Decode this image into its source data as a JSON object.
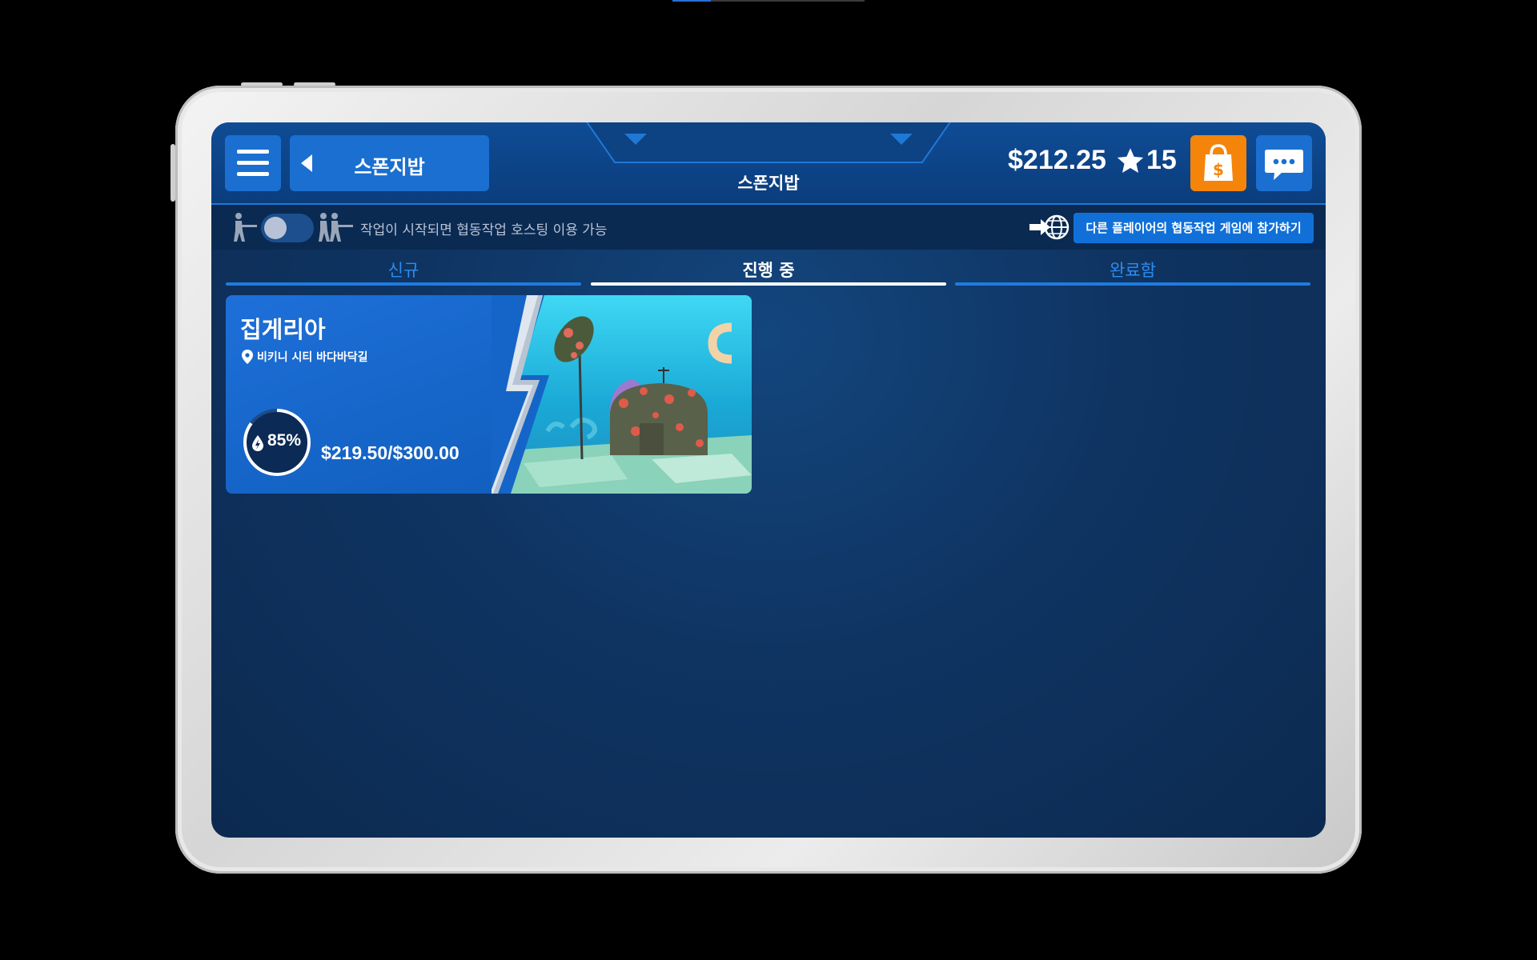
{
  "header": {
    "back_label": "스폰지밥",
    "center_title": "스폰지밥",
    "money": "$212.25",
    "stars": "15",
    "icons": {
      "menu": "hamburger-icon",
      "back": "triangle-left-icon",
      "shop": "shopping-bag-dollar-icon",
      "chat": "chat-bubble-icon",
      "star": "star-icon"
    },
    "colors": {
      "header_bg": "#0f4c95",
      "button_bg": "#1a6fd1",
      "shop_bg": "#f5840b"
    }
  },
  "coop_bar": {
    "hosting_text": "작업이 시작되면 협동작업 호스팅 이용 가능",
    "join_label": "다른 플레이어의 협동작업 게임에 참가하기",
    "toggle_on": false,
    "icons": {
      "single": "single-worker-icon",
      "multi": "multiple-workers-icon",
      "join": "arrow-globe-icon"
    }
  },
  "tabs": [
    {
      "label": "신규",
      "active": false
    },
    {
      "label": "진행 중",
      "active": true
    },
    {
      "label": "완료함",
      "active": false
    }
  ],
  "jobs": [
    {
      "title": "집게리아",
      "location": "비키니 시티 바다바닥길",
      "progress_label": "85%",
      "progress": 0.85,
      "earnings": "$219.50/$300.00",
      "icons": {
        "pin": "map-pin-icon",
        "progress": "wash-drop-icon"
      }
    }
  ]
}
